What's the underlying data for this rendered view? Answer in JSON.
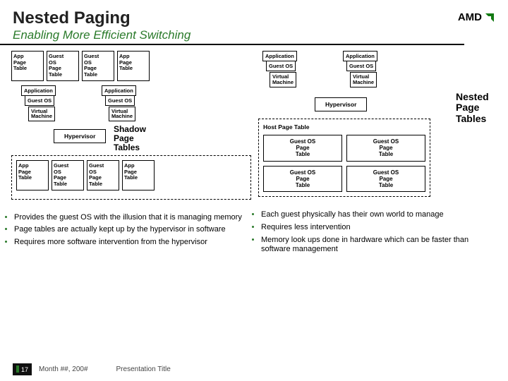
{
  "title": "Nested Paging",
  "subtitle": "Enabling More Efficient Switching",
  "logo_text": "AMD",
  "boxes": {
    "app_pt": "App\nPage\nTable",
    "gos_pt": "Guest\nOS\nPage\nTable",
    "application": "Application",
    "guest_os": "Guest OS",
    "virtual_machine": "Virtual\nMachine",
    "hypervisor": "Hypervisor",
    "shadow_pt": "Shadow\nPage\nTables",
    "nested_pt": "Nested\nPage\nTables",
    "host_pt": "Host Page Table",
    "gos_pt_center": "Guest OS\nPage\nTable"
  },
  "left_bullets": [
    "Provides the guest OS with the illusion that it is managing memory",
    "Page tables are actually kept up by the hypervisor in software",
    "Requires more software intervention from the hypervisor"
  ],
  "right_bullets": [
    "Each guest physically has their own world to manage",
    "Requires less intervention",
    "Memory look ups done in hardware which can be faster than software management"
  ],
  "footer": {
    "page": "17",
    "date": "Month ##, 200#",
    "pres": "Presentation Title"
  }
}
